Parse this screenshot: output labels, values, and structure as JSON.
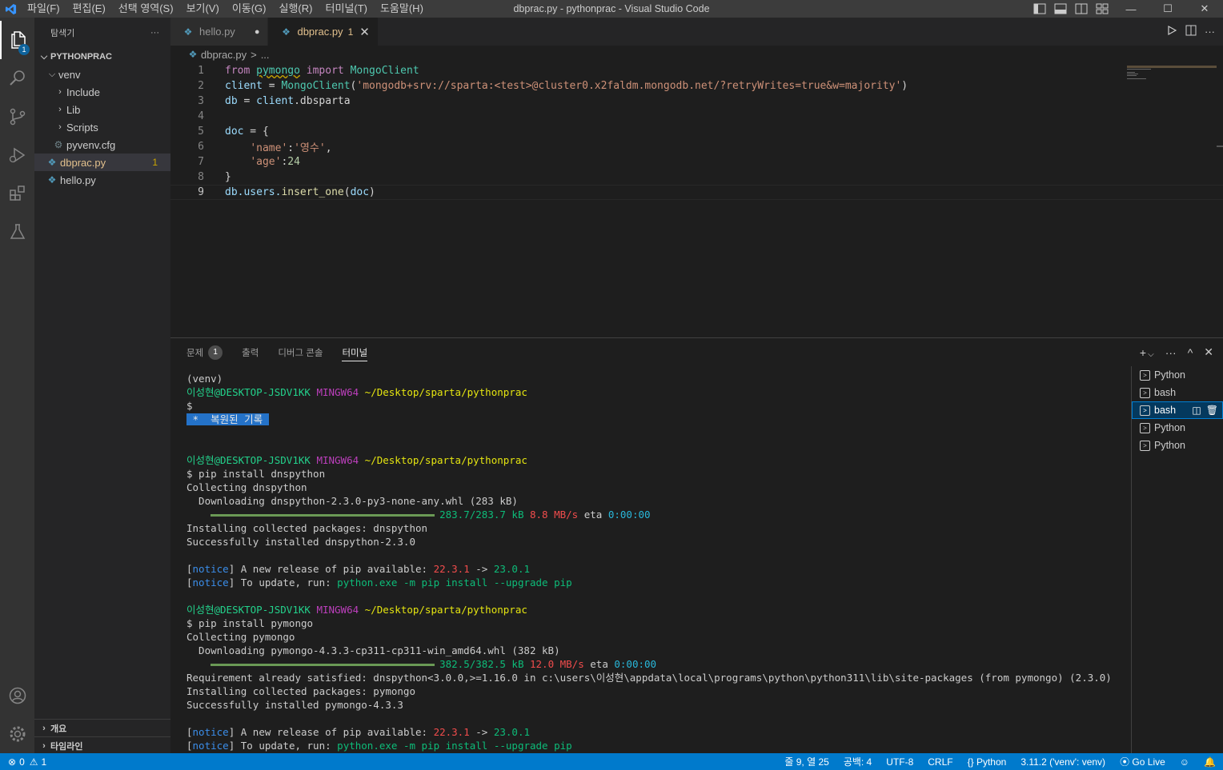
{
  "titlebar": {
    "menu": [
      "파일(F)",
      "편집(E)",
      "선택 영역(S)",
      "보기(V)",
      "이동(G)",
      "실행(R)",
      "터미널(T)",
      "도움말(H)"
    ],
    "title": "dbprac.py - pythonprac - Visual Studio Code",
    "minimize": "—",
    "maximize": "☐",
    "close": "✕"
  },
  "activity": {
    "explorer_badge": "1"
  },
  "sidebar": {
    "header": "탐색기",
    "more": "···",
    "root": "PYTHONPRAC",
    "tree": [
      {
        "label": "venv"
      },
      {
        "label": "Include"
      },
      {
        "label": "Lib"
      },
      {
        "label": "Scripts"
      },
      {
        "label": "pyvenv.cfg"
      },
      {
        "label": "dbprac.py",
        "badge": "1"
      },
      {
        "label": "hello.py"
      }
    ],
    "outline": "개요",
    "timeline": "타임라인"
  },
  "tabs": [
    {
      "label": "hello.py",
      "dirty": "●"
    },
    {
      "label": "dbprac.py",
      "problems": "1",
      "close": "✕"
    }
  ],
  "breadcrumb": {
    "file": "dbprac.py",
    "rest": "...",
    "sep": ">"
  },
  "code": {
    "line_numbers": [
      "1",
      "2",
      "3",
      "4",
      "5",
      "6",
      "7",
      "8",
      "9"
    ],
    "l1": {
      "from": "from",
      "module": "pymongo",
      "import": "import",
      "cls": "MongoClient"
    },
    "l2": {
      "var": "client",
      "eq": " = ",
      "cls": "MongoClient",
      "open": "(",
      "str": "'mongodb+srv://sparta:<test>@cluster0.x2faldm.mongodb.net/?retryWrites=true&w=majority'",
      "close": ")"
    },
    "l3": {
      "var": "db",
      "eq": " = ",
      "obj": "client",
      "attr": ".dbsparta"
    },
    "l5": {
      "var": "doc",
      "eq": " = {"
    },
    "l6": {
      "key": "'name'",
      "colon": ":",
      "val": "'영수'",
      "comma": ","
    },
    "l7": {
      "key": "'age'",
      "colon": ":",
      "val": "24"
    },
    "l8": {
      "text": "}"
    },
    "l9": {
      "obj": "db.users.",
      "fn": "insert_one",
      "open": "(",
      "arg": "doc",
      "close": ")"
    }
  },
  "panel": {
    "tabs": [
      {
        "label": "문제",
        "badge": "1"
      },
      {
        "label": "출력"
      },
      {
        "label": "디버그 콘솔"
      },
      {
        "label": "터미널"
      }
    ],
    "actions": {
      "add": "+",
      "dropdown": "⌵",
      "more": "···",
      "maximize": "^",
      "close": "✕"
    }
  },
  "terminal": {
    "venv": "(venv)",
    "user": "이성현@DESKTOP-JSDV1KK",
    "shell": "MINGW64",
    "path": "~/Desktop/sparta/pythonprac",
    "dollar": "$",
    "restored": " *  복원된 기록 ",
    "cmd1": "$ pip install dnspython",
    "collect1": "Collecting dnspython",
    "download1": "  Downloading dnspython-2.3.0-py3-none-any.whl (283 kB)",
    "prog1": {
      "size": "283.7/283.7 kB",
      "speed": "8.8 MB/s",
      "eta_label": "eta",
      "eta": "0:00:00"
    },
    "install1": "Installing collected packages: dnspython",
    "success1": "Successfully installed dnspython-2.3.0",
    "notice": "notice",
    "notice_text": "A new release of pip available: ",
    "old_ver": "22.3.1",
    "arrow": " -> ",
    "new_ver": "23.0.1",
    "update_text": "To update, run: ",
    "update_cmd": "python.exe -m pip install --upgrade pip",
    "cmd2": "$ pip install pymongo",
    "collect2": "Collecting pymongo",
    "download2": "  Downloading pymongo-4.3.3-cp311-cp311-win_amd64.whl (382 kB)",
    "prog2": {
      "size": "382.5/382.5 kB",
      "speed": "12.0 MB/s",
      "eta_label": "eta",
      "eta": "0:00:00"
    },
    "req": "Requirement already satisfied: dnspython<3.0.0,>=1.16.0 in c:\\users\\이성현\\appdata\\local\\programs\\python\\python311\\lib\\site-packages (from pymongo) (2.3.0)",
    "install2": "Installing collected packages: pymongo",
    "success2": "Successfully installed pymongo-4.3.3"
  },
  "terminal_list": [
    "Python",
    "bash",
    "bash",
    "Python",
    "Python"
  ],
  "statusbar": {
    "errors": "0",
    "warnings": "1",
    "position": "줄 9, 열 25",
    "spaces": "공백: 4",
    "encoding": "UTF-8",
    "eol": "CRLF",
    "language": "Python",
    "interpreter": "3.11.2 ('venv': venv)",
    "golive": "Go Live"
  },
  "colors": {
    "accent": "#007acc",
    "titlebar": "#3c3c3c",
    "activitybar": "#333333",
    "sidebar": "#252526",
    "editor": "#1e1e1e"
  }
}
